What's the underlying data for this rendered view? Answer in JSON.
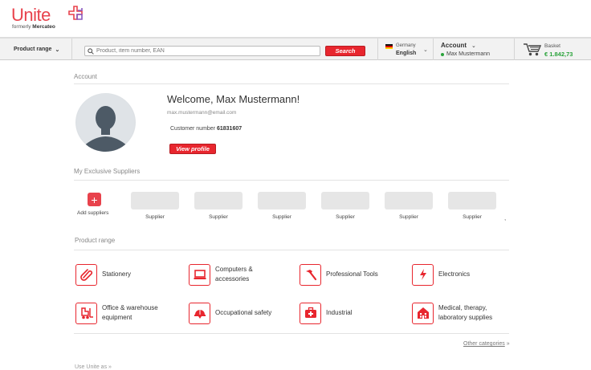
{
  "brand": {
    "name": "Unite",
    "formerly_prefix": "formerly",
    "formerly_name": "Mercateo",
    "accent": "#e8424c"
  },
  "nav": {
    "product_range_label": "Product range",
    "search_placeholder": "Product, item number, EAN",
    "search_button": "Search",
    "country": "Germany",
    "language": "English",
    "account_label": "Account",
    "account_user": "Max Mustermann",
    "basket_label": "Basket",
    "basket_amount": "€ 1.842,73"
  },
  "account": {
    "section_title": "Account",
    "welcome": "Welcome, Max Mustermann!",
    "email": "max.mustermann@email.com",
    "customer_number_label": "Customer number",
    "customer_number": "61831607",
    "view_profile_button": "View profile"
  },
  "suppliers": {
    "section_title": "My Exclusive Suppliers",
    "add_label": "Add suppliers",
    "items": [
      "Supplier",
      "Supplier",
      "Supplier",
      "Supplier",
      "Supplier",
      "Supplier"
    ],
    "more": ","
  },
  "product_range": {
    "section_title": "Product range",
    "categories": [
      {
        "line1": "Stationery",
        "line2": "",
        "icon": "paperclip-icon"
      },
      {
        "line1": "Computers &",
        "line2": "accessories",
        "icon": "laptop-icon"
      },
      {
        "line1": "Professional Tools",
        "line2": "",
        "icon": "hammer-icon"
      },
      {
        "line1": "Electronics",
        "line2": "",
        "icon": "lightning-icon"
      },
      {
        "line1": "Office & warehouse",
        "line2": "equipment",
        "icon": "forklift-icon"
      },
      {
        "line1": "Occupational safety",
        "line2": "",
        "icon": "helmet-icon"
      },
      {
        "line1": "Industrial",
        "line2": "",
        "icon": "first-aid-icon"
      },
      {
        "line1": "Medical, therapy,",
        "line2": "laboratory supplies",
        "icon": "building-icon"
      }
    ],
    "other_categories": "Other categories",
    "other_categories_arrow": "»"
  },
  "footer": {
    "use_unite_as": "Use Unite as",
    "use_unite_as_arrow": "»"
  }
}
